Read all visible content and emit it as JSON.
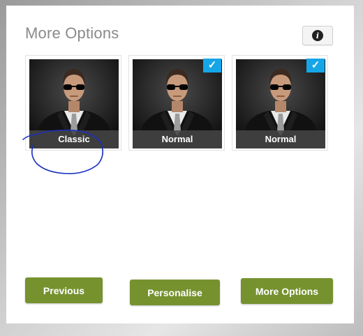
{
  "panel": {
    "title": "More Options"
  },
  "info_button": {
    "icon": "info-icon",
    "glyph": "i"
  },
  "cards": [
    {
      "label": "Classic",
      "selected": false
    },
    {
      "label": "Normal",
      "selected": true
    },
    {
      "label": "Normal",
      "selected": true
    }
  ],
  "check_glyph": "✓",
  "buttons": {
    "previous": "Previous",
    "personalise": "Personalise",
    "more_options": "More Options"
  },
  "colors": {
    "button_green": "#76922f",
    "check_blue": "#16a6e8",
    "annotation_blue": "#1a2fc0"
  }
}
